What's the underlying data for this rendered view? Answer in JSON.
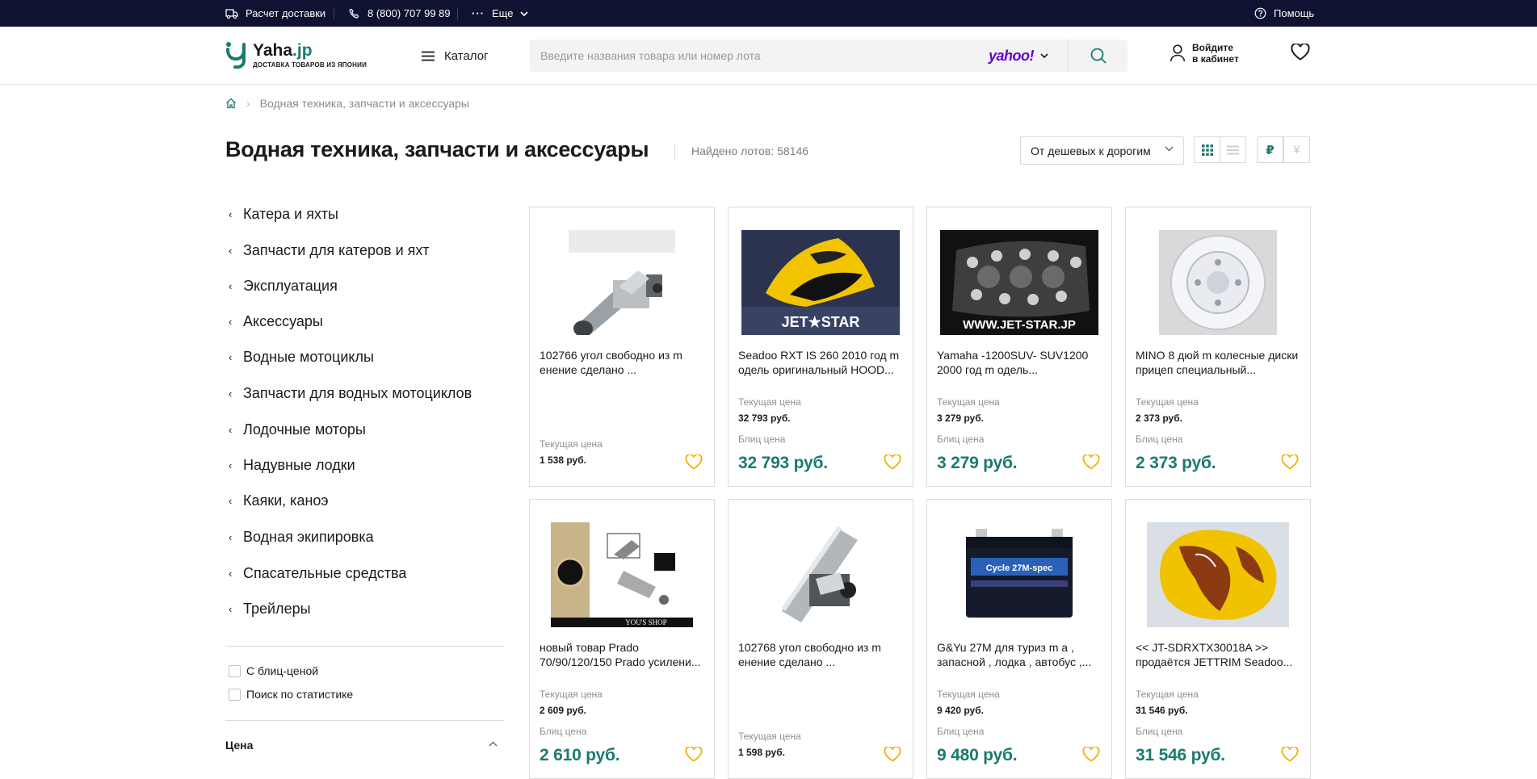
{
  "topbar": {
    "delivery": "Расчет доставки",
    "phone": "8 (800) 707 99 89",
    "more": "Еще",
    "help": "Помощь"
  },
  "header": {
    "logo_name": "Yaha",
    "logo_domain": ".jp",
    "logo_sub": "ДОСТАВКА ТОВАРОВ ИЗ ЯПОНИИ",
    "catalog": "Каталог",
    "search_placeholder": "Введите названия товара или номер лота",
    "search_source": "yahoo!",
    "login_line1": "Войдите",
    "login_line2": "в кабинет"
  },
  "breadcrumb": {
    "current": "Водная техника, запчасти и аксессуары"
  },
  "page": {
    "title": "Водная техника, запчасти и аксессуары",
    "found": "Найдено лотов: 58146",
    "sort": "От дешевых к дорогим",
    "currency_rub": "₽",
    "currency_yen": "¥"
  },
  "categories": [
    "Катера и яхты",
    "Запчасти для катеров и яхт",
    "Эксплуатация",
    "Аксессуары",
    "Водные мотоциклы",
    "Запчасти для водных мотоциклов",
    "Лодочные моторы",
    "Надувные лодки",
    "Каяки, каноэ",
    "Водная экипировка",
    "Спасательные средства",
    "Трейлеры"
  ],
  "filters": {
    "blitz": "С блиц-ценой",
    "stats": "Поиск по статистике",
    "price": "Цена"
  },
  "labels": {
    "current_price": "Текущая цена",
    "blitz_price": "Блиц цена"
  },
  "products": [
    {
      "name": "102766 угол свободно из m енение сделано ...",
      "current": "1 538 руб.",
      "blitz": ""
    },
    {
      "name": "Seadoo RXT IS 260 2010 год m одель оригинальный HOOD...",
      "current": "32 793 руб.",
      "blitz": "32 793 руб.",
      "img_text": "JET★STAR"
    },
    {
      "name": "Yamaha -1200SUV- SUV1200 2000 год m одель...",
      "current": "3 279 руб.",
      "blitz": "3 279 руб.",
      "img_text": "WWW.JET-STAR.JP"
    },
    {
      "name": "MINO 8 дюй m колесные диски прицеп специальный...",
      "current": "2 373 руб.",
      "blitz": "2 373 руб."
    },
    {
      "name": "новый товар Prado 70/90/120/150 Prado усилени...",
      "current": "2 609 руб.",
      "blitz": "2 610 руб.",
      "img_text": "YOU'S SHOP"
    },
    {
      "name": "102768 угол свободно из m енение сделано ...",
      "current": "1 598 руб.",
      "blitz": ""
    },
    {
      "name": "G&Yu 27M для туриз m а , запасной , лодка , автобус ,...",
      "current": "9 420 руб.",
      "blitz": "9 480 руб.",
      "img_text": "Cycle 27M-spec"
    },
    {
      "name": "<< JT-SDRXTX30018A >> продаётся JETTRIM Seadoo...",
      "current": "31 546 руб.",
      "blitz": "31 546 руб."
    }
  ],
  "colors": {
    "topbar": "#0f1230",
    "accent": "#1b7a70",
    "fav": "#f2b200"
  }
}
